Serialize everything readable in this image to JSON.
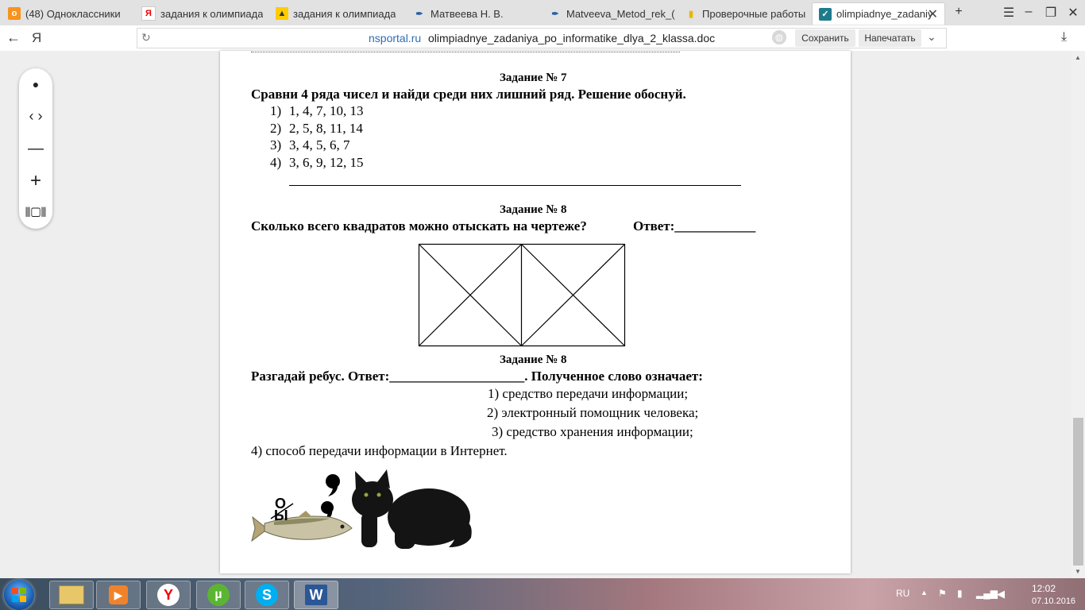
{
  "browser": {
    "tabs": [
      {
        "title": "(48) Одноклассники",
        "icon": "odnoklassniki-icon"
      },
      {
        "title": "задания к олимпиада",
        "icon": "yandex-icon"
      },
      {
        "title": "задания к олимпиада",
        "icon": "image-tab-icon"
      },
      {
        "title": "Матвеева Н. В.",
        "icon": "pen-nib-icon"
      },
      {
        "title": "Matveeva_Metod_rek_(",
        "icon": "pen-nib-icon"
      },
      {
        "title": "Проверочные работы",
        "icon": "note-icon"
      },
      {
        "title": "olimpiadnye_zadaniy",
        "icon": "check-doc-icon",
        "active": true
      }
    ],
    "address": {
      "host": "nsportal.ru",
      "path": "olimpiadnye_zadaniya_po_informatike_dlya_2_klassa.doc",
      "yandex_letter": "Я"
    },
    "save_label": "Сохранить",
    "print_label": "Напечатать"
  },
  "document": {
    "task7": {
      "heading": "Задание № 7",
      "question": "Сравни 4 ряда чисел и найди среди них лишний ряд. Решение обоснуй.",
      "items": [
        {
          "num": "1)",
          "text": "1, 4, 7, 10, 13"
        },
        {
          "num": "2)",
          "text": "2, 5, 8, 11, 14"
        },
        {
          "num": "3)",
          "text": "3, 4, 5, 6, 7"
        },
        {
          "num": "4)",
          "text": "3, 6, 9, 12, 15"
        }
      ]
    },
    "task8a": {
      "heading": "Задание № 8",
      "question": "Сколько всего квадратов можно отыскать на чертеже?",
      "answer_label": "Ответ:____________"
    },
    "task8b": {
      "heading": "Задание № 8",
      "question": "Разгадай ребус. Ответ:____________________. Полученное слово означает:",
      "options": [
        "1) средство передачи информации;",
        "2) электронный помощник человека;",
        "3) средство хранения информации;",
        "4) способ передачи информации в Интернет."
      ],
      "rebus_letter_o": "О",
      "rebus_letter_y": "Ы"
    }
  },
  "taskbar": {
    "apps": [
      "start-orb",
      "explorer-icon",
      "media-player-icon",
      "yandex-browser-icon",
      "utorrent-icon",
      "skype-icon",
      "word-icon"
    ],
    "language": "RU",
    "time": "12:02",
    "date": "07.10.2016"
  }
}
